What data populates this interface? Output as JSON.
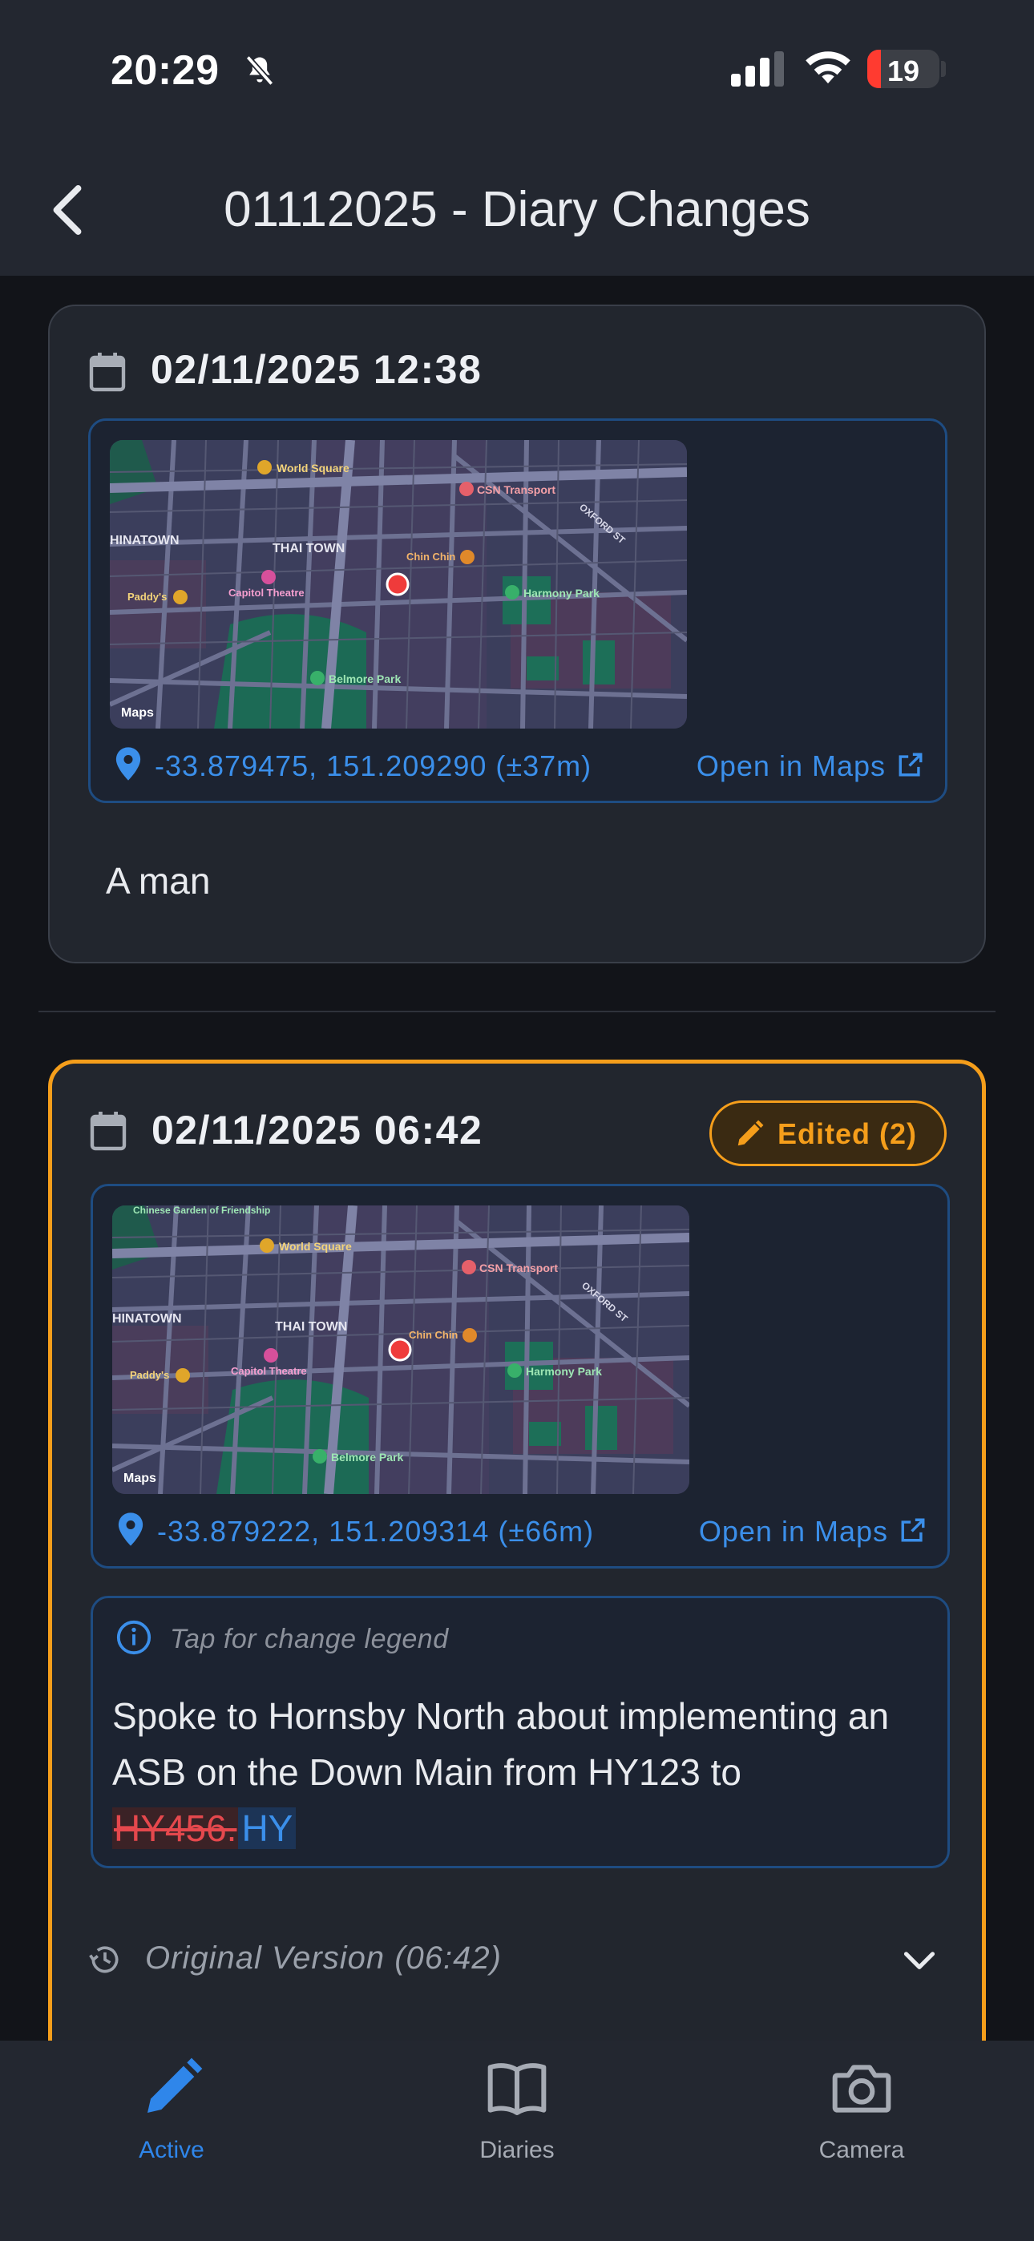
{
  "status_bar": {
    "time": "20:29",
    "battery": "19",
    "battery_level": 0.19
  },
  "header": {
    "title": "01112025 - Diary Changes"
  },
  "entries": [
    {
      "datetime": "02/11/2025 12:38",
      "coords": "-33.879475, 151.209290 (±37m)",
      "open_maps": "Open in Maps",
      "note": "A man"
    },
    {
      "datetime": "02/11/2025 06:42",
      "badge": "Edited (2)",
      "coords": "-33.879222, 151.209314 (±66m)",
      "open_maps": "Open in Maps",
      "legend_hint": "Tap for change legend",
      "text_unchanged": "Spoke to Hornsby North about implementing an ASB on the Down Main from HY123 to ",
      "text_deleted": "HY456.",
      "text_inserted": "HY",
      "original_version": "Original Version (06:42)"
    }
  ],
  "map_labels": {
    "world_square": "World Square",
    "csn": "CSN Transport",
    "oxford": "OXFORD ST",
    "chinatown": "HINATOWN",
    "thai_town": "THAI TOWN",
    "chin_chin": "Chin Chin",
    "capitol": "Capitol Theatre",
    "paddys": "Paddy's",
    "harmony": "Harmony Park",
    "belmore": "Belmore Park",
    "maps": "Maps",
    "garden": "Chinese Garden of Friendship"
  },
  "tabs": [
    {
      "label": "Active",
      "icon": "pencil-icon"
    },
    {
      "label": "Diaries",
      "icon": "book-icon"
    },
    {
      "label": "Camera",
      "icon": "camera-icon"
    }
  ],
  "colors": {
    "accent_blue": "#3b8fea",
    "edited_orange": "#f59e1b",
    "deleted_red": "#e5484d",
    "background": "#121419",
    "card": "#22262e"
  }
}
